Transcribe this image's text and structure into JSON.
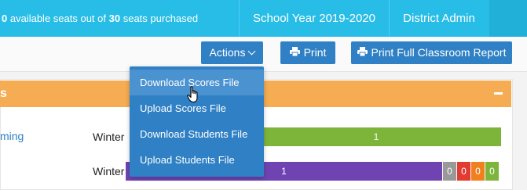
{
  "topbar": {
    "seats_available": "0",
    "seats_text_1": "available seats out of",
    "seats_total": "30",
    "seats_text_2": "seats purchased",
    "school_year": "School Year 2019-2020",
    "role": "District Admin"
  },
  "toolbar": {
    "actions_label": "Actions",
    "print_label": "Print",
    "report_label": "Print Full Classroom Report"
  },
  "actions_menu": {
    "items": [
      {
        "label": "Download Scores File",
        "hovered": true
      },
      {
        "label": "Upload Scores File"
      },
      {
        "label": "Download Students File"
      },
      {
        "label": "Upload Students File"
      }
    ]
  },
  "panel": {
    "header_fragment": "s",
    "row_link_fragment": "ming",
    "rows": [
      {
        "season": "Winter",
        "bar_value": "1",
        "bar_color": "#7db53b"
      },
      {
        "season": "Winter",
        "bar_value": "1",
        "bar_color": "#7043b3",
        "segments": [
          "0",
          "0",
          "0",
          "0"
        ]
      }
    ]
  },
  "colors": {
    "topbar": "#27bde6",
    "button": "#2f80c4",
    "panel_header": "#f5ac52",
    "green": "#7db53b",
    "purple": "#7043b3",
    "red": "#e23b32",
    "orange": "#f07f1e",
    "grey": "#999999"
  }
}
